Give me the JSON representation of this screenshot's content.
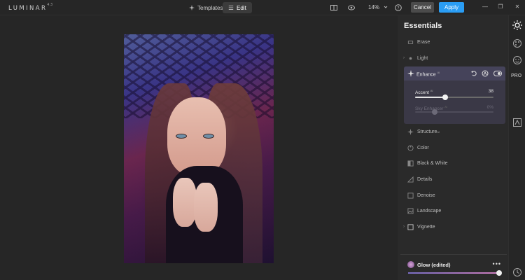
{
  "app": {
    "name": "LUMINAR",
    "version": "4.3"
  },
  "toolbar": {
    "templates_label": "Templates",
    "edit_label": "Edit",
    "zoom_value": "14%",
    "cancel_label": "Cancel",
    "apply_label": "Apply"
  },
  "panel": {
    "title": "Essentials",
    "tools": [
      {
        "label": "Erase",
        "expander": ""
      },
      {
        "label": "Light",
        "expander": "›"
      },
      {
        "label": "Structure",
        "ai": "AI",
        "expander": ""
      },
      {
        "label": "Color",
        "expander": ""
      },
      {
        "label": "Black & White",
        "expander": ""
      },
      {
        "label": "Details",
        "expander": ""
      },
      {
        "label": "Denoise",
        "expander": ""
      },
      {
        "label": "Landscape",
        "expander": ""
      },
      {
        "label": "Vignette",
        "expander": "›"
      }
    ],
    "enhance": {
      "label": "Enhance",
      "ai": "AI",
      "sliders": [
        {
          "label": "Accent",
          "ai": "AI",
          "value": 38,
          "max": 100,
          "display": "38"
        },
        {
          "label": "Sky Enhancer",
          "ai": "AI",
          "value": 0,
          "max": 100,
          "display": "0%"
        }
      ]
    }
  },
  "preset": {
    "name": "Glow (edited)",
    "more": "•••",
    "amount": 100
  },
  "rail": {
    "pro_label": "PRO"
  },
  "colors": {
    "accent": "#2a9df4",
    "enhance_bg": "#3a3846"
  }
}
